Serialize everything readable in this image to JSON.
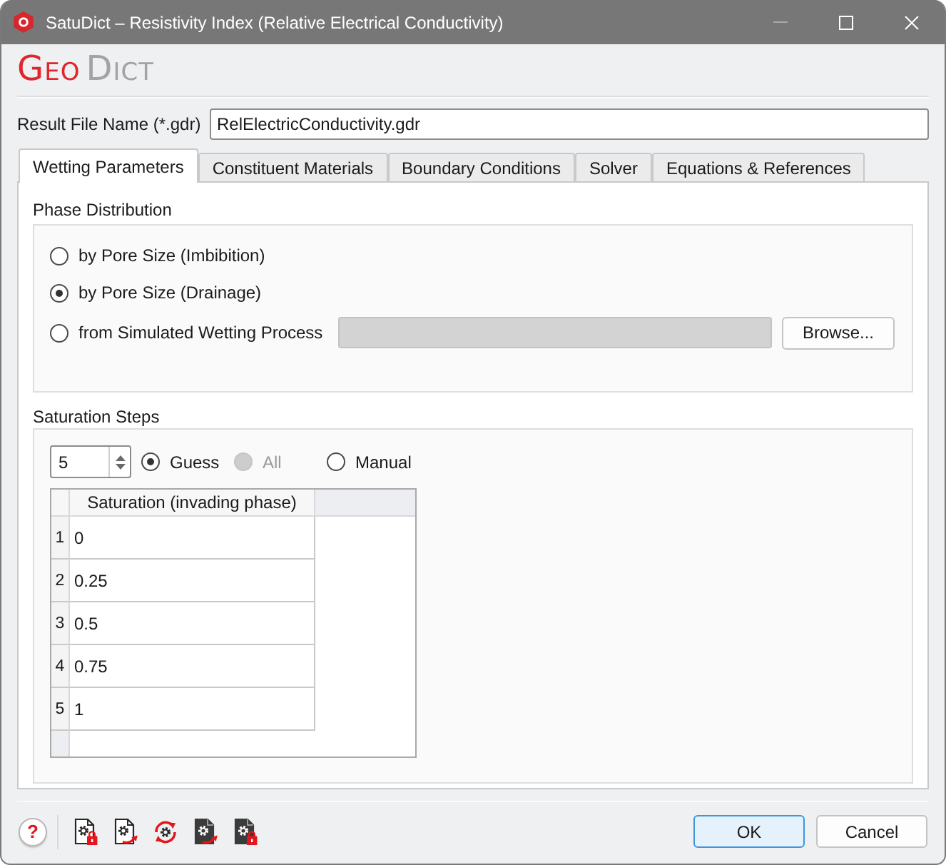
{
  "window": {
    "title": "SatuDict – Resistivity Index (Relative Electrical Conductivity)",
    "controls": [
      {
        "kind": "minimize",
        "disabled": true
      },
      {
        "kind": "maximize",
        "disabled": false
      },
      {
        "kind": "close",
        "disabled": false
      }
    ]
  },
  "logo": {
    "first": "GEO",
    "second": "DICT"
  },
  "result_file": {
    "label": "Result File Name (*.gdr)",
    "value": "RelElectricConductivity.gdr"
  },
  "tabs": [
    {
      "label": "Wetting Parameters",
      "selected": true
    },
    {
      "label": "Constituent Materials",
      "selected": false
    },
    {
      "label": "Boundary Conditions",
      "selected": false
    },
    {
      "label": "Solver",
      "selected": false
    },
    {
      "label": "Equations & References",
      "selected": false
    }
  ],
  "phase_distribution": {
    "title": "Phase Distribution",
    "options": [
      {
        "kind": "plain",
        "label": "by Pore Size (Imbibition)",
        "selected": false
      },
      {
        "kind": "plain",
        "label": "by Pore Size (Drainage)",
        "selected": true
      },
      {
        "kind": "file",
        "label": "from Simulated Wetting Process",
        "selected": false,
        "field_disabled": true,
        "button": "Browse..."
      }
    ]
  },
  "saturation_steps": {
    "title": "Saturation Steps",
    "count": "5",
    "modes": [
      {
        "label": "Guess",
        "selected": true,
        "disabled": false
      },
      {
        "label": "All",
        "selected": false,
        "disabled": true
      },
      {
        "label": "Manual",
        "selected": false,
        "disabled": false
      }
    ],
    "table": {
      "columns": [
        "Saturation (invading phase)"
      ],
      "rows": [
        {
          "number": "1",
          "value": "0"
        },
        {
          "number": "2",
          "value": "0.25"
        },
        {
          "number": "3",
          "value": "0.5"
        },
        {
          "number": "4",
          "value": "0.75"
        },
        {
          "number": "5",
          "value": "1"
        }
      ]
    }
  },
  "toolbar": {
    "help": "?"
  },
  "buttons": [
    {
      "label": "OK",
      "default": true
    },
    {
      "label": "Cancel",
      "default": false
    }
  ]
}
